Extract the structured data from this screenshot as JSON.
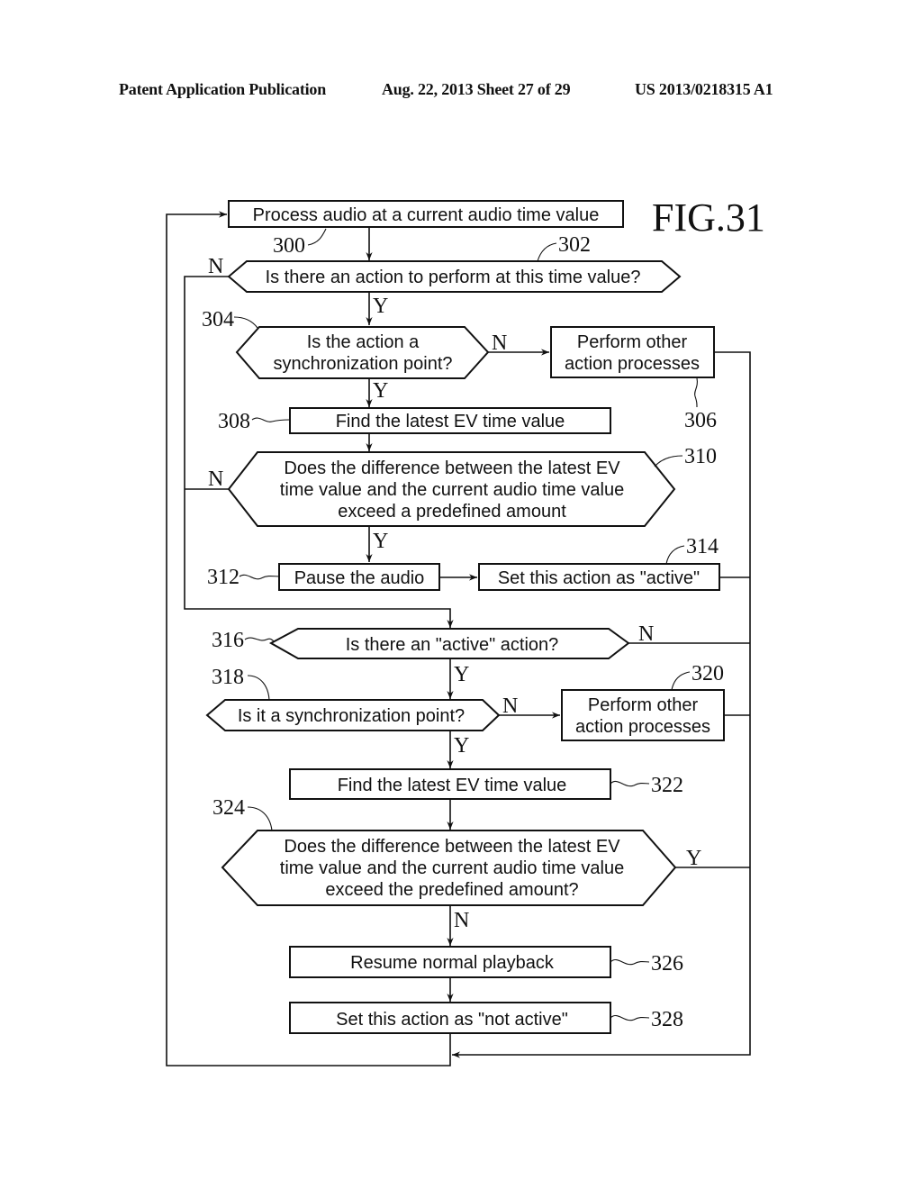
{
  "header": {
    "publication": "Patent Application Publication",
    "date_sheet": "Aug. 22, 2013  Sheet 27 of 29",
    "number": "US 2013/0218315 A1"
  },
  "figure_label": "FIG.31",
  "nodes": {
    "n300": {
      "ref": "300",
      "lines": [
        "Process audio at a current audio time value"
      ]
    },
    "n302": {
      "ref": "302",
      "lines": [
        "Is there an action to perform at this time value?"
      ]
    },
    "n304": {
      "ref": "304",
      "lines": [
        "Is the action a",
        "synchronization point?"
      ]
    },
    "n306": {
      "ref": "306",
      "lines": [
        "Perform other",
        "action processes"
      ]
    },
    "n308": {
      "ref": "308",
      "lines": [
        "Find the latest EV time value"
      ]
    },
    "n310": {
      "ref": "310",
      "lines": [
        "Does the difference between the latest EV",
        "time value and the current audio time value",
        "exceed a predefined amount"
      ]
    },
    "n312": {
      "ref": "312",
      "lines": [
        "Pause the audio"
      ]
    },
    "n314": {
      "ref": "314",
      "lines": [
        "Set this action as \"active\""
      ]
    },
    "n316": {
      "ref": "316",
      "lines": [
        "Is there an \"active\" action?"
      ]
    },
    "n318": {
      "ref": "318",
      "lines": [
        "Is it a synchronization point?"
      ]
    },
    "n320": {
      "ref": "320",
      "lines": [
        "Perform other",
        "action processes"
      ]
    },
    "n322": {
      "ref": "322",
      "lines": [
        "Find the latest EV time value"
      ]
    },
    "n324": {
      "ref": "324",
      "lines": [
        "Does the difference between the latest EV",
        "time value and the current audio time value",
        "exceed the predefined amount?"
      ]
    },
    "n326": {
      "ref": "326",
      "lines": [
        "Resume normal playback"
      ]
    },
    "n328": {
      "ref": "328",
      "lines": [
        "Set this action as \"not active\""
      ]
    }
  },
  "edge_labels": {
    "yes": "Y",
    "no": "N"
  }
}
